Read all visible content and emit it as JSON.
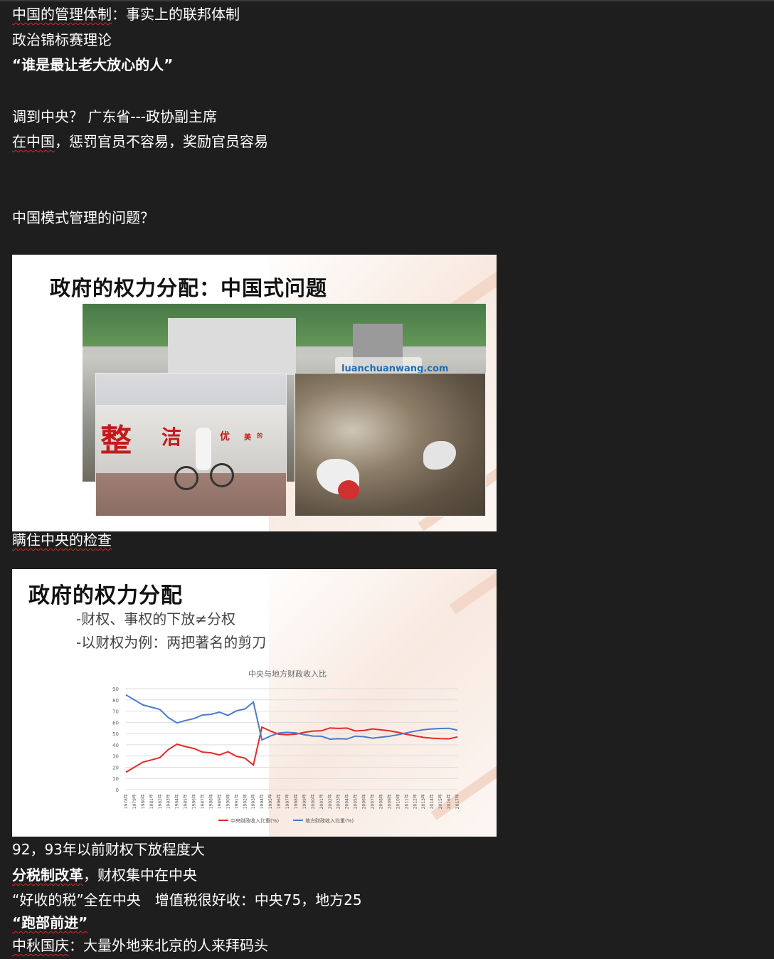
{
  "lines": {
    "l1": {
      "a": "中国的管理体制",
      "b": "：事实上的联邦体制"
    },
    "l2": "政治锦标赛理论",
    "l3": "“谁是最让老大放心的人”",
    "l4": "调到中央？ 广东省---政协副主席",
    "l5": {
      "a": "在中国",
      "b": "，惩罚官员不容易，奖励官员容易"
    },
    "l6": "中国模式管理的问题？",
    "l7": "瞒住中央的检查",
    "l8": "92，93年以前财权下放程度大",
    "l9": {
      "a": "分税制改革",
      "b": "，财权集中在中央"
    },
    "l10": "“好收的税”全在中央　增值税很好收：中央75，地方25",
    "l11": "“跑部前进”",
    "l12": {
      "a": "中秋国庆",
      "b": "：大量外地来北京的人来拜码头"
    }
  },
  "slide1": {
    "title": "政府的权力分配：中国式问题",
    "wall_chars": [
      "整",
      "洁",
      "优",
      "美",
      "的"
    ],
    "logo_text": "luanchuanwang.com"
  },
  "slide2": {
    "title": "政府的权力分配",
    "bullets": [
      "-财权、事权的下放≠分权",
      "-以财权为例：两把著名的剪刀"
    ]
  },
  "colors": {
    "background": "#1e1e1e",
    "central_line": "#e02b2b",
    "local_line": "#4a7bc8",
    "squiggle": "#d22a2a"
  },
  "chart_data": {
    "type": "line",
    "title": "中央与地方财政收入比",
    "x": [
      "1978年",
      "1979年",
      "1980年",
      "1981年",
      "1982年",
      "1983年",
      "1984年",
      "1985年",
      "1986年",
      "1987年",
      "1988年",
      "1989年",
      "1990年",
      "1991年",
      "1992年",
      "1993年",
      "1994年",
      "1995年",
      "1996年",
      "1997年",
      "1998年",
      "1999年",
      "2000年",
      "2001年",
      "2002年",
      "2003年",
      "2004年",
      "2005年",
      "2006年",
      "2007年",
      "2008年",
      "2009年",
      "2010年",
      "2011年",
      "2012年",
      "2013年",
      "2014年",
      "2015年",
      "2016年",
      "2017年"
    ],
    "series": [
      {
        "name": "中央财政收入比重(%)",
        "values": [
          15.5,
          20,
          24.5,
          26.5,
          28.6,
          35.8,
          40.5,
          38.4,
          36.7,
          33.5,
          32.9,
          30.9,
          33.8,
          29.8,
          28.1,
          22,
          55.7,
          52.2,
          49.4,
          48.9,
          49.5,
          51.1,
          52.2,
          52.4,
          55,
          54.6,
          54.9,
          52.3,
          52.8,
          54.1,
          53.3,
          52.4,
          51.1,
          49.4,
          47.9,
          46.6,
          45.9,
          45.5,
          45.3,
          47
        ]
      },
      {
        "name": "地方财政收入比重(%)",
        "values": [
          84.5,
          80,
          75.5,
          73.5,
          71.4,
          64.2,
          59.5,
          61.6,
          63.3,
          66.5,
          67.1,
          69.1,
          66.2,
          70.2,
          71.9,
          78,
          44.3,
          47.8,
          50.6,
          51.1,
          50.5,
          48.9,
          47.8,
          47.6,
          45,
          45.4,
          45.1,
          47.7,
          47.2,
          45.9,
          46.7,
          47.6,
          48.9,
          50.6,
          52.1,
          53.4,
          54.1,
          54.5,
          54.7,
          53
        ]
      }
    ],
    "yticks": [
      0,
      10,
      20,
      30,
      40,
      50,
      60,
      70,
      80,
      90
    ],
    "ylim": [
      0,
      90
    ],
    "grid": true,
    "legend": "bottom"
  }
}
